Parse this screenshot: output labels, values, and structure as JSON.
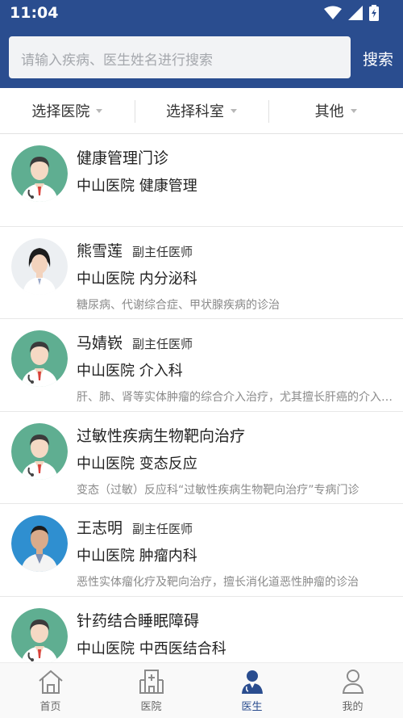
{
  "status": {
    "time": "11:04"
  },
  "search": {
    "placeholder": "请输入疾病、医生姓名进行搜索",
    "button": "搜索"
  },
  "filters": [
    "选择医院",
    "选择科室",
    "其他"
  ],
  "doctors": [
    {
      "name": "健康管理门诊",
      "title": "",
      "dept": "中山医院 健康管理",
      "desc": "",
      "avatar": "default"
    },
    {
      "name": "熊雪莲",
      "title": "副主任医师",
      "dept": "中山医院 内分泌科",
      "desc": "糖尿病、代谢综合症、甲状腺疾病的诊治",
      "avatar": "female-photo"
    },
    {
      "name": "马婧嵚",
      "title": "副主任医师",
      "dept": "中山医院 介入科",
      "desc": "肝、肺、肾等实体肿瘤的综合介入治疗，尤其擅长肝癌的介入治疗",
      "avatar": "default"
    },
    {
      "name": "过敏性疾病生物靶向治疗",
      "title": "",
      "dept": "中山医院 变态反应",
      "desc": "变态（过敏）反应科“过敏性疾病生物靶向治疗”专病门诊",
      "avatar": "default"
    },
    {
      "name": "王志明",
      "title": "副主任医师",
      "dept": "中山医院 肿瘤内科",
      "desc": "恶性实体瘤化疗及靶向治疗，擅长消化道恶性肿瘤的诊治",
      "avatar": "male-photo"
    },
    {
      "name": "针药结合睡眠障碍",
      "title": "",
      "dept": "中山医院 中西医结合科",
      "desc": "",
      "avatar": "default"
    }
  ],
  "tabs": [
    {
      "label": "首页",
      "icon": "home-icon",
      "active": false
    },
    {
      "label": "医院",
      "icon": "hospital-icon",
      "active": false
    },
    {
      "label": "医生",
      "icon": "doctor-icon",
      "active": true
    },
    {
      "label": "我的",
      "icon": "user-icon",
      "active": false
    }
  ],
  "colors": {
    "primary": "#2a4d8f",
    "avatar_bg": "#5fae91"
  }
}
